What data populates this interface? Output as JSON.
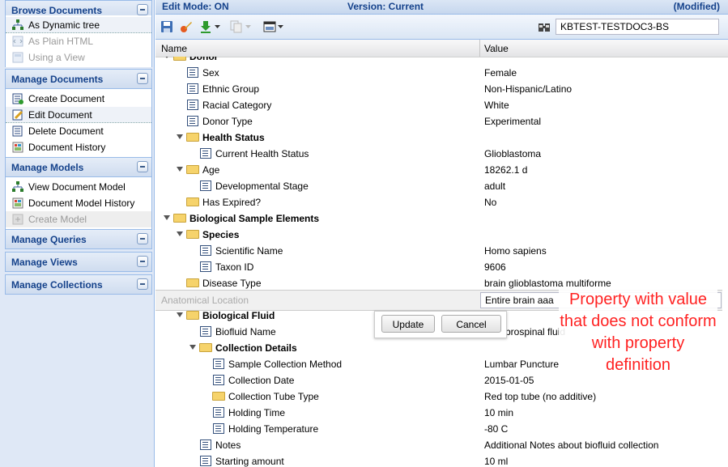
{
  "sidebar": {
    "sections": [
      {
        "title": "Browse Documents",
        "items": [
          {
            "label": "As Dynamic tree",
            "icon": "tree-icon",
            "state": "selected"
          },
          {
            "label": "As Plain HTML",
            "icon": "html-icon",
            "state": "disabled"
          },
          {
            "label": "Using a View",
            "icon": "view-icon",
            "state": "disabled"
          }
        ]
      },
      {
        "title": "Manage Documents",
        "items": [
          {
            "label": "Create Document",
            "icon": "create-doc-icon",
            "state": "normal"
          },
          {
            "label": "Edit Document",
            "icon": "edit-doc-icon",
            "state": "selected"
          },
          {
            "label": "Delete Document",
            "icon": "delete-doc-icon",
            "state": "normal"
          },
          {
            "label": "Document History",
            "icon": "history-icon",
            "state": "normal"
          }
        ]
      },
      {
        "title": "Manage Models",
        "items": [
          {
            "label": "View Document Model",
            "icon": "tree-icon",
            "state": "normal"
          },
          {
            "label": "Document Model History",
            "icon": "history-icon",
            "state": "normal"
          },
          {
            "label": "Create Model",
            "icon": "create-model-icon",
            "state": "disabled-bg"
          }
        ]
      },
      {
        "title": "Manage Queries",
        "items": []
      },
      {
        "title": "Manage Views",
        "items": []
      },
      {
        "title": "Manage Collections",
        "items": []
      }
    ]
  },
  "header": {
    "edit_mode": "Edit Mode: ON",
    "version": "Version: Current",
    "modified": "(Modified)"
  },
  "toolbar": {
    "document_name": "KBTEST-TESTDOC3-BS",
    "icons": [
      "save-icon",
      "edit-icon",
      "download-icon",
      "copy-icon",
      "display-icon",
      "documents-icon"
    ]
  },
  "columns": {
    "name": "Name",
    "value": "Value"
  },
  "rows": [
    {
      "name": "Donor",
      "value": "",
      "kind": "folder",
      "level": 1,
      "bold": true,
      "expanded": true
    },
    {
      "name": "Sex",
      "value": "Female",
      "kind": "prop",
      "level": 2
    },
    {
      "name": "Ethnic Group",
      "value": "Non-Hispanic/Latino",
      "kind": "prop",
      "level": 2
    },
    {
      "name": "Racial Category",
      "value": "White",
      "kind": "prop",
      "level": 2
    },
    {
      "name": "Donor Type",
      "value": "Experimental",
      "kind": "prop",
      "level": 2
    },
    {
      "name": "Health Status",
      "value": "",
      "kind": "folder",
      "level": 2,
      "bold": true,
      "expanded": true
    },
    {
      "name": "Current Health Status",
      "value": "Glioblastoma",
      "kind": "prop",
      "level": 3
    },
    {
      "name": "Age",
      "value": "18262.1 d",
      "kind": "folder",
      "level": 2,
      "expanded": true
    },
    {
      "name": "Developmental Stage",
      "value": "adult",
      "kind": "prop",
      "level": 3
    },
    {
      "name": "Has Expired?",
      "value": "No",
      "kind": "folder",
      "level": 2
    },
    {
      "name": "Biological Sample Elements",
      "value": "",
      "kind": "folder",
      "level": 1,
      "bold": true,
      "expanded": true
    },
    {
      "name": "Species",
      "value": "",
      "kind": "folder",
      "level": 2,
      "bold": true,
      "expanded": true
    },
    {
      "name": "Scientific Name",
      "value": "Homo sapiens",
      "kind": "prop",
      "level": 3
    },
    {
      "name": "Taxon ID",
      "value": "9606",
      "kind": "prop",
      "level": 3
    },
    {
      "name": "Disease Type",
      "value": "brain glioblastoma multiforme",
      "kind": "folder",
      "level": 2
    },
    {
      "name": "Anatomical Location",
      "value": "Entire brain aaa",
      "kind": "edit",
      "level": 2
    },
    {
      "name": "Biological Fluid",
      "value": "",
      "kind": "folder",
      "level": 2,
      "bold": true,
      "expanded": true
    },
    {
      "name": "Biofluid Name",
      "value": "Cerebrospinal fluid",
      "kind": "prop",
      "level": 3
    },
    {
      "name": "Collection Details",
      "value": "",
      "kind": "folder",
      "level": 3,
      "bold": true,
      "expanded": true
    },
    {
      "name": "Sample Collection Method",
      "value": "Lumbar Puncture",
      "kind": "prop",
      "level": 4
    },
    {
      "name": "Collection Date",
      "value": "2015-01-05",
      "kind": "prop",
      "level": 4
    },
    {
      "name": "Collection Tube Type",
      "value": "Red top tube (no additive)",
      "kind": "folder",
      "level": 4
    },
    {
      "name": "Holding Time",
      "value": "10 min",
      "kind": "prop",
      "level": 4
    },
    {
      "name": "Holding Temperature",
      "value": "-80 C",
      "kind": "prop",
      "level": 4
    },
    {
      "name": "Notes",
      "value": "Additional Notes about biofluid collection",
      "kind": "prop",
      "level": 3
    },
    {
      "name": "Starting amount",
      "value": "10 ml",
      "kind": "prop",
      "level": 3
    }
  ],
  "editor": {
    "update_label": "Update",
    "cancel_label": "Cancel"
  },
  "annotation": {
    "text": "Property with value that does not conform with property definition",
    "color": "#ff2222"
  },
  "colors": {
    "accent": "#15428b",
    "panel": "#dfe8f6"
  }
}
